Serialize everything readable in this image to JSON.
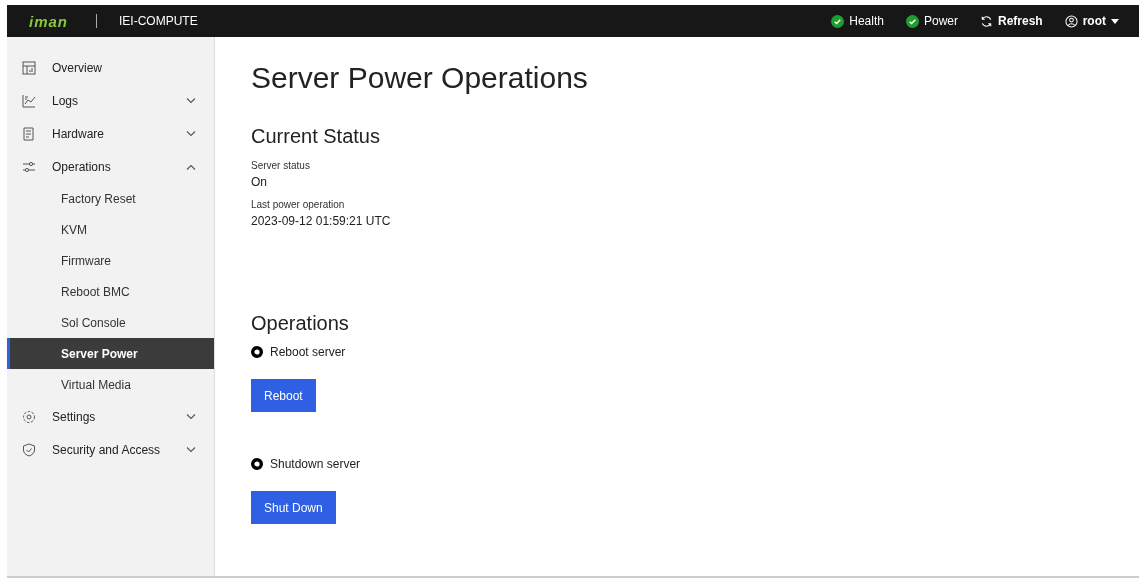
{
  "header": {
    "logo": "iman",
    "host": "IEI-COMPUTE",
    "status": [
      {
        "label": "Health",
        "color": "#1e9e2e"
      },
      {
        "label": "Power",
        "color": "#1e9e2e"
      }
    ],
    "refresh": "Refresh",
    "user": "root"
  },
  "sidebar": {
    "items": [
      {
        "label": "Overview",
        "kind": "link",
        "selected": false
      },
      {
        "label": "Logs",
        "kind": "group",
        "expanded": false,
        "selected": false
      },
      {
        "label": "Hardware",
        "kind": "group",
        "expanded": false,
        "selected": false
      },
      {
        "label": "Operations",
        "kind": "group",
        "expanded": true,
        "selected": false,
        "children": [
          {
            "label": "Factory Reset",
            "selected": false
          },
          {
            "label": "KVM",
            "selected": false
          },
          {
            "label": "Firmware",
            "selected": false
          },
          {
            "label": "Reboot BMC",
            "selected": false
          },
          {
            "label": "Sol Console",
            "selected": false
          },
          {
            "label": "Server Power",
            "selected": true
          },
          {
            "label": "Virtual Media",
            "selected": false
          }
        ]
      },
      {
        "label": "Settings",
        "kind": "group",
        "expanded": false,
        "selected": false
      },
      {
        "label": "Security and Access",
        "kind": "group",
        "expanded": false,
        "selected": false
      }
    ]
  },
  "page": {
    "title": "Server Power Operations",
    "status_heading": "Current Status",
    "fields": [
      {
        "label": "Server status",
        "value": "On"
      },
      {
        "label": "Last power operation",
        "value": "2023-09-12 01:59:21 UTC"
      }
    ],
    "operations_heading": "Operations",
    "operations": [
      {
        "label": "Reboot server",
        "button": "Reboot"
      },
      {
        "label": "Shutdown server",
        "button": "Shut Down"
      }
    ]
  }
}
